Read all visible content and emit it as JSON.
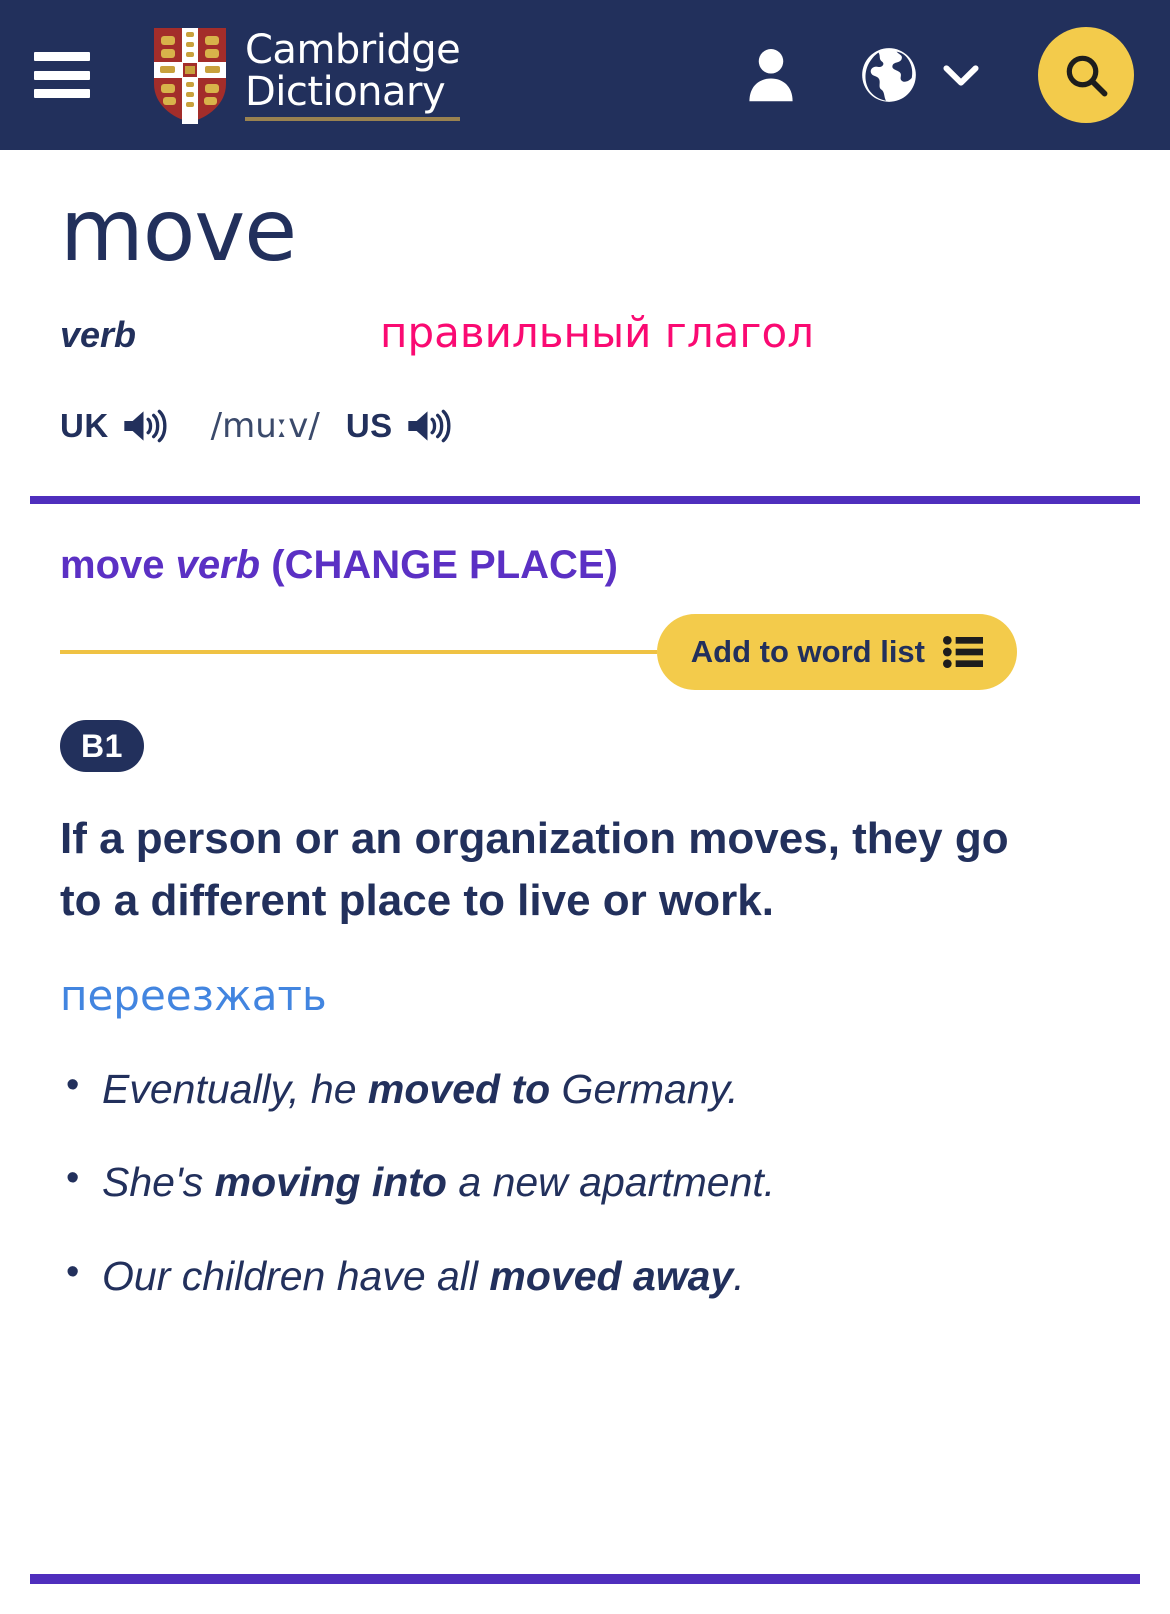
{
  "header": {
    "menu_icon": "hamburger-icon",
    "brand_line1": "Cambridge",
    "brand_line2": "Dictionary",
    "profile_icon": "person-icon",
    "language_icon": "globe-icon",
    "language_chevron_icon": "chevron-down-icon",
    "search_icon": "search-icon",
    "background_color": "#22305c",
    "accent_color": "#f3cb4b"
  },
  "entry": {
    "headword": "move",
    "part_of_speech": "verb",
    "pos_translation": "правильный глагол",
    "pos_translation_color": "#fa0a72",
    "uk_label": "UK",
    "us_label": "US",
    "ipa": "/muːv/",
    "speaker_icon": "speaker-icon"
  },
  "sense": {
    "headword": "move",
    "pos": "verb",
    "guideword": "(CHANGE PLACE)",
    "add_to_word_list_label": "Add to word list",
    "word_list_icon": "list-icon",
    "cefr_level": "B1",
    "definition": "If a person or an organization moves, they go to a different place to live or work.",
    "definition_translation": "переезжать",
    "definition_translation_color": "#4285e0",
    "examples": [
      {
        "before": "Eventually, he ",
        "bold": "moved to",
        "after": " Germany."
      },
      {
        "before": "She's ",
        "bold": "moving into",
        "after": " a new apartment."
      },
      {
        "before": "Our children have all ",
        "bold": "moved away",
        "after": "."
      }
    ]
  },
  "colors": {
    "navy": "#22305c",
    "purple_rule": "#4f2ebd",
    "sense_purple": "#5b30c4",
    "amber": "#efc243"
  }
}
